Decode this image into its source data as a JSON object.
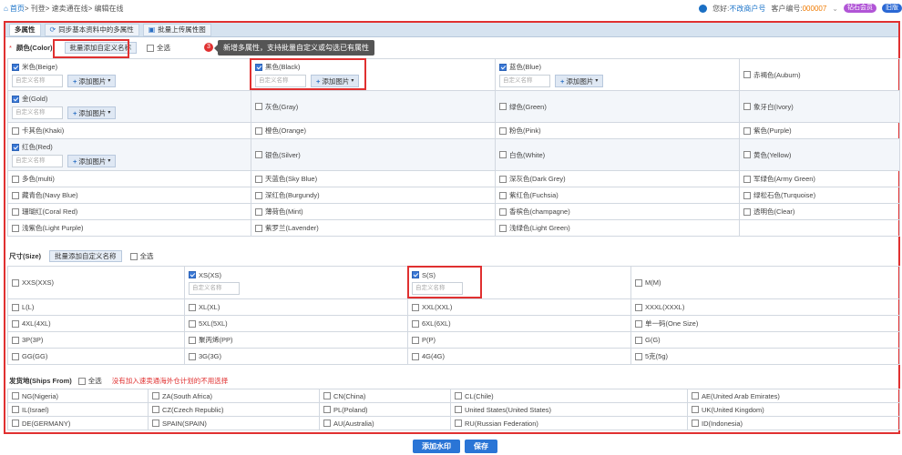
{
  "breadcrumb": {
    "home": "首页",
    "rest": " > 刊登> 速卖通在线> 编辑在线"
  },
  "header": {
    "greeting": "您好:",
    "user": "不改商户号",
    "customer_label": "客户编号:",
    "customer_no": "000007",
    "vip": "钻石会员",
    "msg": "旧版"
  },
  "tabs": [
    {
      "label": "多属性"
    },
    {
      "label": "同步基本资料中的多属性"
    },
    {
      "label": "批量上传属性图"
    }
  ],
  "color": {
    "title": "颜色(Color)",
    "batch_btn": "批量添加自定义名称",
    "select_all": "全选",
    "placeholder": "自定义名称",
    "add_image": "添加图片",
    "rows": [
      [
        {
          "n": "米色(Beige)",
          "c": true,
          "x": true
        },
        {
          "n": "黑色(Black)",
          "c": true,
          "x": true
        },
        {
          "n": "蓝色(Blue)",
          "c": true,
          "x": true
        },
        {
          "n": "赤褐色(Auburn)",
          "c": false,
          "x": false
        }
      ],
      [
        {
          "n": "金(Gold)",
          "c": true,
          "x": true
        },
        {
          "n": "灰色(Gray)",
          "c": false,
          "x": false
        },
        {
          "n": "绿色(Green)",
          "c": false,
          "x": false
        },
        {
          "n": "象牙白(Ivory)",
          "c": false,
          "x": false
        }
      ],
      [
        {
          "n": "卡其色(Khaki)",
          "c": false,
          "x": false
        },
        {
          "n": "橙色(Orange)",
          "c": false,
          "x": false
        },
        {
          "n": "粉色(Pink)",
          "c": false,
          "x": false
        },
        {
          "n": "紫色(Purple)",
          "c": false,
          "x": false
        }
      ],
      [
        {
          "n": "红色(Red)",
          "c": true,
          "x": true
        },
        {
          "n": "银色(Silver)",
          "c": false,
          "x": false
        },
        {
          "n": "白色(White)",
          "c": false,
          "x": false
        },
        {
          "n": "黄色(Yellow)",
          "c": false,
          "x": false
        }
      ],
      [
        {
          "n": "多色(multi)",
          "c": false,
          "x": false
        },
        {
          "n": "天蓝色(Sky Blue)",
          "c": false,
          "x": false
        },
        {
          "n": "深灰色(Dark Grey)",
          "c": false,
          "x": false
        },
        {
          "n": "军绿色(Army Green)",
          "c": false,
          "x": false
        }
      ],
      [
        {
          "n": "藏青色(Navy Blue)",
          "c": false,
          "x": false
        },
        {
          "n": "深红色(Burgundy)",
          "c": false,
          "x": false
        },
        {
          "n": "紫红色(Fuchsia)",
          "c": false,
          "x": false
        },
        {
          "n": "绿松石色(Turquoise)",
          "c": false,
          "x": false
        }
      ],
      [
        {
          "n": "珊瑚红(Coral Red)",
          "c": false,
          "x": false
        },
        {
          "n": "薄荷色(Mint)",
          "c": false,
          "x": false
        },
        {
          "n": "香槟色(champagne)",
          "c": false,
          "x": false
        },
        {
          "n": "透明色(Clear)",
          "c": false,
          "x": false
        }
      ],
      [
        {
          "n": "浅紫色(Light Purple)",
          "c": false,
          "x": false
        },
        {
          "n": "紫罗兰(Lavender)",
          "c": false,
          "x": false
        },
        {
          "n": "浅绿色(Light Green)",
          "c": false,
          "x": false
        },
        {
          "n": "",
          "c": false,
          "x": false
        }
      ]
    ]
  },
  "tooltip": {
    "num": "3",
    "text": "新增多属性，支持批量自定义或勾选已有属性"
  },
  "size": {
    "title": "尺寸(Size)",
    "batch_btn": "批量添加自定义名称",
    "select_all": "全选",
    "placeholder": "自定义名称",
    "rows": [
      [
        {
          "n": "XXS(XXS)",
          "c": false,
          "x": false
        },
        {
          "n": "XS(XS)",
          "c": true,
          "x": true
        },
        {
          "n": "S(S)",
          "c": true,
          "x": true
        },
        {
          "n": "M(M)",
          "c": false,
          "x": false
        }
      ],
      [
        {
          "n": "L(L)",
          "c": false,
          "x": false
        },
        {
          "n": "XL(XL)",
          "c": false,
          "x": false
        },
        {
          "n": "XXL(XXL)",
          "c": false,
          "x": false
        },
        {
          "n": "XXXL(XXXL)",
          "c": false,
          "x": false
        }
      ],
      [
        {
          "n": "4XL(4XL)",
          "c": false,
          "x": false
        },
        {
          "n": "5XL(5XL)",
          "c": false,
          "x": false
        },
        {
          "n": "6XL(6XL)",
          "c": false,
          "x": false
        },
        {
          "n": "单一码(One Size)",
          "c": false,
          "x": false
        }
      ],
      [
        {
          "n": "3P(3P)",
          "c": false,
          "x": false
        },
        {
          "n": "聚丙烯(PP)",
          "c": false,
          "x": false
        },
        {
          "n": "P(P)",
          "c": false,
          "x": false
        },
        {
          "n": "G(G)",
          "c": false,
          "x": false
        }
      ],
      [
        {
          "n": "GG(GG)",
          "c": false,
          "x": false
        },
        {
          "n": "3G(3G)",
          "c": false,
          "x": false
        },
        {
          "n": "4G(4G)",
          "c": false,
          "x": false
        },
        {
          "n": "5克(5g)",
          "c": false,
          "x": false
        }
      ]
    ]
  },
  "ships": {
    "title": "发货地(Ships From)",
    "select_all": "全选",
    "warning": "没有加入速卖通海外仓计划的不用选择",
    "rows": [
      [
        "NG(Nigeria)",
        "ZA(South Africa)",
        "CN(China)",
        "CL(Chile)",
        "AE(United Arab Emirates)"
      ],
      [
        "IL(Israel)",
        "CZ(Czech Republic)",
        "PL(Poland)",
        "United States(United States)",
        "UK(United Kingdom)"
      ],
      [
        "DE(GERMANY)",
        "SPAIN(SPAIN)",
        "AU(Australia)",
        "RU(Russian Federation)",
        "ID(Indonesia)"
      ]
    ]
  },
  "footer": {
    "watermark": "添加水印",
    "save": "保存"
  }
}
